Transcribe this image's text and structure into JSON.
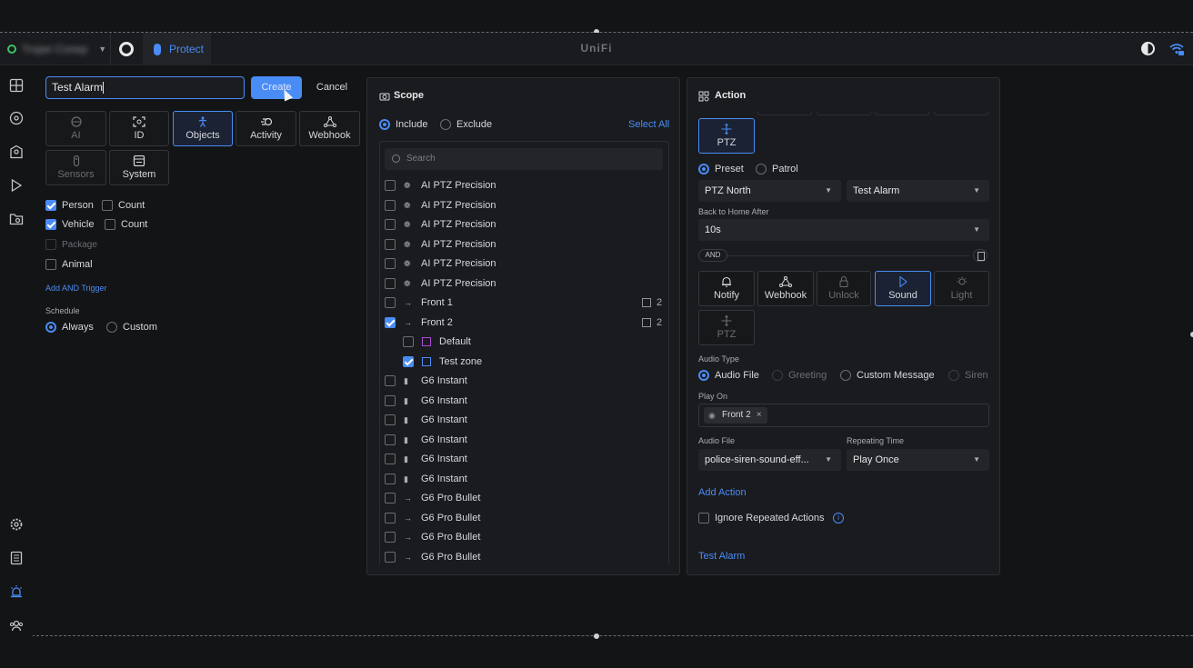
{
  "topbar": {
    "site_name": "Trojan Conep",
    "app_label": "Protect",
    "brand": "UniFi"
  },
  "sidebar": {
    "icons": [
      "dashboard-icon",
      "devices-icon",
      "map-icon",
      "play-icon",
      "folder-icon",
      "settings-icon",
      "logs-icon",
      "alarm-icon",
      "users-icon"
    ]
  },
  "editor": {
    "name_value": "Test Alarm",
    "create_label": "Create",
    "cancel_label": "Cancel",
    "trigger_tiles": [
      {
        "label": "AI",
        "icon": "ai-icon",
        "state": "dim"
      },
      {
        "label": "ID",
        "icon": "id-icon",
        "state": "normal"
      },
      {
        "label": "Objects",
        "icon": "person-icon",
        "state": "selected"
      },
      {
        "label": "Activity",
        "icon": "activity-icon",
        "state": "normal"
      },
      {
        "label": "Webhook",
        "icon": "webhook-icon",
        "state": "normal"
      },
      {
        "label": "Sensors",
        "icon": "sensor-icon",
        "state": "dim"
      },
      {
        "label": "System",
        "icon": "system-icon",
        "state": "normal"
      }
    ],
    "objects": [
      {
        "label": "Person",
        "checked": true,
        "count_label": "Count"
      },
      {
        "label": "Vehicle",
        "checked": true,
        "count_label": "Count"
      },
      {
        "label": "Package",
        "checked": false,
        "disabled": true
      },
      {
        "label": "Animal",
        "checked": false
      }
    ],
    "add_trigger_label": "Add AND Trigger",
    "schedule_label": "Schedule",
    "schedule_options": [
      "Always",
      "Custom"
    ],
    "schedule_selected": "Always"
  },
  "scope": {
    "title": "Scope",
    "include_label": "Include",
    "exclude_label": "Exclude",
    "select_all_label": "Select All",
    "search_placeholder": "Search",
    "items": [
      {
        "label": "AI PTZ Precision",
        "checked": false,
        "icon": "ptz-camera-icon"
      },
      {
        "label": "AI PTZ Precision",
        "checked": false,
        "icon": "ptz-camera-icon"
      },
      {
        "label": "AI PTZ Precision",
        "checked": false,
        "icon": "ptz-camera-icon"
      },
      {
        "label": "AI PTZ Precision",
        "checked": false,
        "icon": "ptz-camera-icon"
      },
      {
        "label": "AI PTZ Precision",
        "checked": false,
        "icon": "ptz-camera-icon"
      },
      {
        "label": "AI PTZ Precision",
        "checked": false,
        "icon": "ptz-camera-icon"
      },
      {
        "label": "Front 1",
        "checked": false,
        "icon": "bullet-camera-icon",
        "zones": "2"
      },
      {
        "label": "Front 2",
        "checked": true,
        "icon": "bullet-camera-icon",
        "zones": "2"
      },
      {
        "label": "Default",
        "checked": false,
        "icon": "zone-icon",
        "child": true,
        "color": "#b048d8"
      },
      {
        "label": "Test zone",
        "checked": true,
        "icon": "zone-icon",
        "child": true,
        "color": "#4a8cf6"
      },
      {
        "label": "G6 Instant",
        "checked": false,
        "icon": "instant-camera-icon"
      },
      {
        "label": "G6 Instant",
        "checked": false,
        "icon": "instant-camera-icon"
      },
      {
        "label": "G6 Instant",
        "checked": false,
        "icon": "instant-camera-icon"
      },
      {
        "label": "G6 Instant",
        "checked": false,
        "icon": "instant-camera-icon"
      },
      {
        "label": "G6 Instant",
        "checked": false,
        "icon": "instant-camera-icon"
      },
      {
        "label": "G6 Instant",
        "checked": false,
        "icon": "instant-camera-icon"
      },
      {
        "label": "G6 Pro Bullet",
        "checked": false,
        "icon": "bullet-camera-icon"
      },
      {
        "label": "G6 Pro Bullet",
        "checked": false,
        "icon": "bullet-camera-icon"
      },
      {
        "label": "G6 Pro Bullet",
        "checked": false,
        "icon": "bullet-camera-icon"
      },
      {
        "label": "G6 Pro Bullet",
        "checked": false,
        "icon": "bullet-camera-icon"
      }
    ]
  },
  "action": {
    "title": "Action",
    "ptz_tile_label": "PTZ",
    "preset_label": "Preset",
    "patrol_label": "Patrol",
    "ptz_camera_value": "PTZ North",
    "preset_value": "Test Alarm",
    "back_home_label": "Back to Home After",
    "back_home_value": "10s",
    "and_label": "AND",
    "action_tiles": [
      {
        "label": "Notify",
        "icon": "bell-icon",
        "state": "normal"
      },
      {
        "label": "Webhook",
        "icon": "webhook-icon",
        "state": "normal"
      },
      {
        "label": "Unlock",
        "icon": "lock-icon",
        "state": "dim"
      },
      {
        "label": "Sound",
        "icon": "play-icon",
        "state": "selected"
      },
      {
        "label": "Light",
        "icon": "bulb-icon",
        "state": "dim"
      },
      {
        "label": "PTZ",
        "icon": "ptz-icon",
        "state": "dim"
      }
    ],
    "audio_type_label": "Audio Type",
    "audio_types": [
      {
        "label": "Audio File",
        "selected": true,
        "disabled": false
      },
      {
        "label": "Greeting",
        "selected": false,
        "disabled": true
      },
      {
        "label": "Custom Message",
        "selected": false,
        "disabled": false
      },
      {
        "label": "Siren",
        "selected": false,
        "disabled": true
      }
    ],
    "play_on_label": "Play On",
    "play_on_chip": "Front 2",
    "chip_remove": "×",
    "audio_file_label": "Audio File",
    "audio_file_value": "police-siren-sound-eff...",
    "repeating_label": "Repeating Time",
    "repeating_value": "Play Once",
    "add_action_label": "Add Action",
    "ignore_repeated_label": "Ignore Repeated Actions",
    "footer_alarm_label": "Test Alarm"
  },
  "colors": {
    "accent": "#4a8cf6",
    "background": "#131416",
    "panel": "#1a1b1e",
    "zone_purple": "#b048d8",
    "status_green": "#3fbf63"
  }
}
